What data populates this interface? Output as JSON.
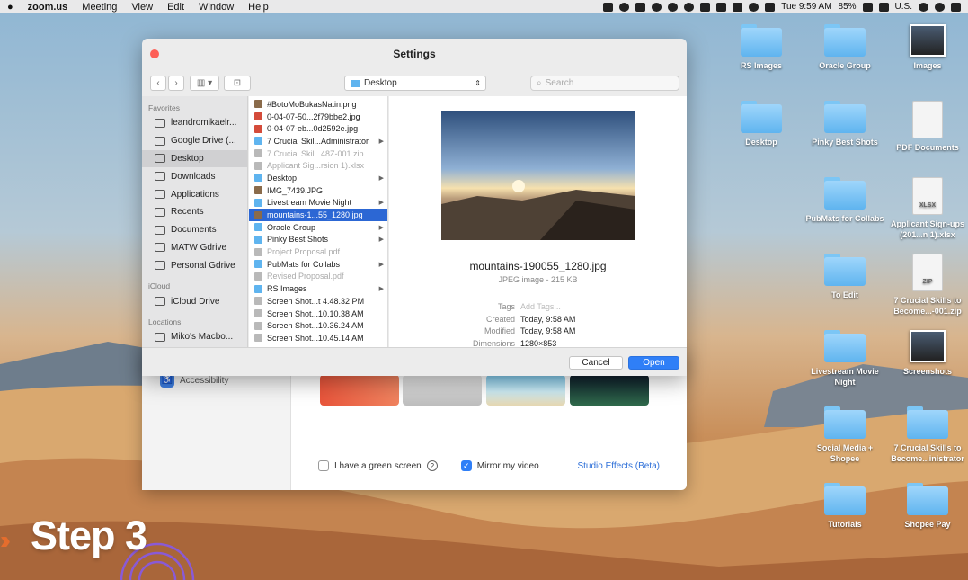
{
  "menubar": {
    "apple": "",
    "app": "zoom.us",
    "menus": [
      "Meeting",
      "View",
      "Edit",
      "Window",
      "Help"
    ],
    "clock": "Tue 9:59 AM",
    "battery": "85%",
    "input": "U.S."
  },
  "desktop": {
    "icons": [
      {
        "label": "RS Images",
        "kind": "folder"
      },
      {
        "label": "Oracle Group",
        "kind": "folder"
      },
      {
        "label": "Images",
        "kind": "photo"
      },
      {
        "label": "Desktop",
        "kind": "folder"
      },
      {
        "label": "Pinky Best Shots",
        "kind": "folder"
      },
      {
        "label": "PDF Documents",
        "kind": "file"
      },
      {
        "label": "PubMats for Collabs",
        "kind": "folder"
      },
      {
        "label": "Applicant Sign-ups (201...n 1).xlsx",
        "kind": "file",
        "badge": "XLSX"
      },
      {
        "label": "To Edit",
        "kind": "folder"
      },
      {
        "label": "7 Crucial Skills to Become...-001.zip",
        "kind": "file",
        "badge": "ZIP"
      },
      {
        "label": "Livestream Movie Night",
        "kind": "folder"
      },
      {
        "label": "Screenshots",
        "kind": "photo"
      },
      {
        "label": "Social Media + Shopee",
        "kind": "folder"
      },
      {
        "label": "7 Crucial Skills to Become...inistrator",
        "kind": "folder"
      },
      {
        "label": "Tutorials",
        "kind": "folder"
      },
      {
        "label": "Shopee Pay",
        "kind": "folder"
      }
    ]
  },
  "zoom": {
    "accessibility": "Accessibility",
    "green_screen": "I have a green screen",
    "mirror": "Mirror my video",
    "studio": "Studio Effects (Beta)"
  },
  "dialog": {
    "title": "Settings",
    "location": "Desktop",
    "search_placeholder": "Search",
    "sidebar": {
      "favorites_header": "Favorites",
      "favorites": [
        "leandromikaelr...",
        "Google Drive (...",
        "Desktop",
        "Downloads",
        "Applications",
        "Recents",
        "Documents",
        "MATW Gdrive",
        "Personal Gdrive"
      ],
      "icloud_header": "iCloud",
      "icloud": [
        "iCloud Drive"
      ],
      "locations_header": "Locations",
      "locations": [
        "Miko's Macbo..."
      ]
    },
    "files": [
      {
        "name": "#BotoMoBukasNatin.png",
        "type": "img"
      },
      {
        "name": "0-04-07-50...2f79bbe2.jpg",
        "type": "doc"
      },
      {
        "name": "0-04-07-eb...0d2592e.jpg",
        "type": "doc"
      },
      {
        "name": "7 Crucial Skil...Administrator",
        "type": "folder",
        "arrow": true
      },
      {
        "name": "7 Crucial Skil...48Z-001.zip",
        "type": "file",
        "dim": true
      },
      {
        "name": "Applicant Sig...rsion 1).xlsx",
        "type": "file",
        "dim": true
      },
      {
        "name": "Desktop",
        "type": "folder",
        "arrow": true
      },
      {
        "name": "IMG_7439.JPG",
        "type": "img"
      },
      {
        "name": "Livestream Movie Night",
        "type": "folder",
        "arrow": true
      },
      {
        "name": "mountains-1...55_1280.jpg",
        "type": "img",
        "selected": true
      },
      {
        "name": "Oracle Group",
        "type": "folder",
        "arrow": true
      },
      {
        "name": "Pinky Best Shots",
        "type": "folder",
        "arrow": true
      },
      {
        "name": "Project Proposal.pdf",
        "type": "file",
        "dim": true
      },
      {
        "name": "PubMats for Collabs",
        "type": "folder",
        "arrow": true
      },
      {
        "name": "Revised Proposal.pdf",
        "type": "file",
        "dim": true
      },
      {
        "name": "RS Images",
        "type": "folder",
        "arrow": true
      },
      {
        "name": "Screen Shot...t 4.48.32 PM",
        "type": "file"
      },
      {
        "name": "Screen Shot...10.10.38 AM",
        "type": "file"
      },
      {
        "name": "Screen Shot...10.36.24 AM",
        "type": "file"
      },
      {
        "name": "Screen Shot...10.45.14 AM",
        "type": "file"
      }
    ],
    "preview": {
      "name": "mountains-190055_1280.jpg",
      "kind": "JPEG image - 215 KB",
      "meta": [
        {
          "k": "Tags",
          "v": "Add Tags...",
          "placeholder": true
        },
        {
          "k": "Created",
          "v": "Today, 9:58 AM"
        },
        {
          "k": "Modified",
          "v": "Today, 9:58 AM"
        },
        {
          "k": "Dimensions",
          "v": "1280×853"
        }
      ]
    },
    "cancel": "Cancel",
    "open": "Open"
  },
  "overlay": {
    "step": "Step 3"
  }
}
